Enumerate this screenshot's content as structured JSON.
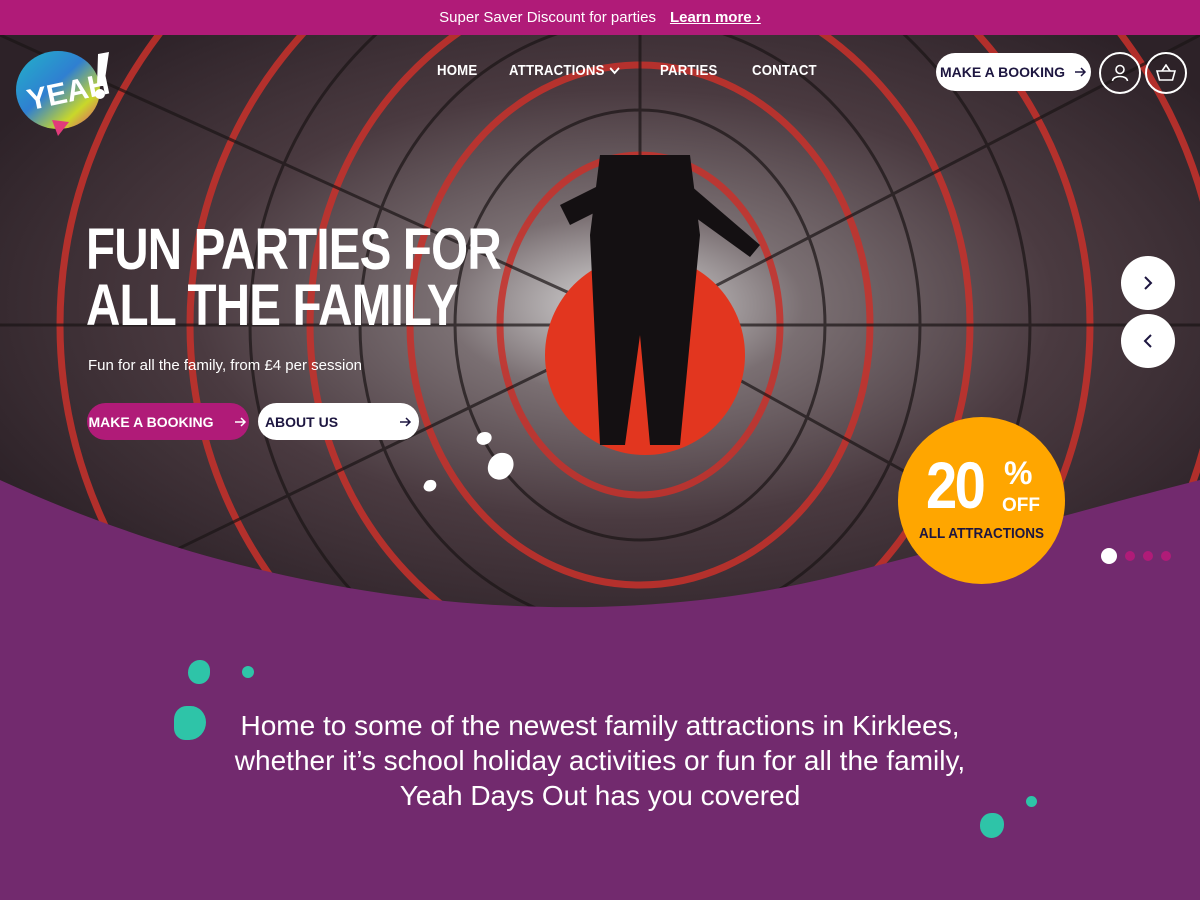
{
  "announcement": {
    "text": "Super Saver Discount for parties",
    "link": "Learn more ›"
  },
  "logo": {
    "text": "YEAH!"
  },
  "nav": {
    "items": [
      "HOME",
      "ATTRACTIONS",
      "PARTIES",
      "CONTACT"
    ],
    "booking": "MAKE A BOOKING"
  },
  "hero": {
    "title_line1": "FUN PARTIES FOR",
    "title_line2": "ALL THE FAMILY",
    "subtitle": "Fun for all the family, from £4 per session",
    "primary_button": "MAKE A BOOKING",
    "secondary_button": "ABOUT US"
  },
  "promo": {
    "percent": "20",
    "percent_sign": "%",
    "off": "OFF",
    "label": "ALL ATTRACTIONS"
  },
  "carousel": {
    "slide_count": 4,
    "active_slide": 1
  },
  "intro": {
    "text": "Home to some of the newest family attractions in Kirklees, whether it’s school holiday activities or fun for all the family, Yeah Days Out has you covered"
  },
  "colors": {
    "brand_pink": "#b01b78",
    "brand_purple": "#722a6e",
    "promo_orange": "#ffa600",
    "teal": "#2ec4a8",
    "navy": "#1d1640"
  },
  "icons": [
    "chevron-down-icon",
    "arrow-right-icon",
    "user-icon",
    "basket-icon",
    "chevron-right-icon",
    "chevron-left-icon"
  ]
}
